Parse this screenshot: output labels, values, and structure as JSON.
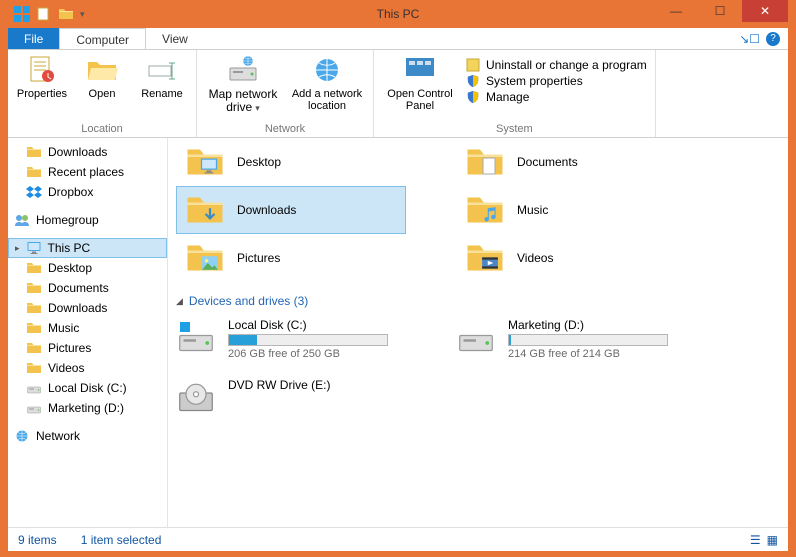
{
  "title": "This PC",
  "tabs": {
    "file": "File",
    "computer": "Computer",
    "view": "View"
  },
  "ribbon": {
    "location": {
      "label": "Location",
      "properties": "Properties",
      "open": "Open",
      "rename": "Rename"
    },
    "network": {
      "label": "Network",
      "map": "Map network drive",
      "add": "Add a network location"
    },
    "system": {
      "label": "System",
      "panel": "Open Control Panel",
      "uninstall": "Uninstall or change a program",
      "props": "System properties",
      "manage": "Manage"
    }
  },
  "nav": {
    "downloads": "Downloads",
    "recent": "Recent places",
    "dropbox": "Dropbox",
    "homegroup": "Homegroup",
    "thispc": "This PC",
    "desktop": "Desktop",
    "documents": "Documents",
    "downloads2": "Downloads",
    "music": "Music",
    "pictures": "Pictures",
    "videos": "Videos",
    "localc": "Local Disk (C:)",
    "marketingd": "Marketing (D:)",
    "network": "Network"
  },
  "folders": {
    "left": [
      "Desktop",
      "Downloads",
      "Pictures"
    ],
    "right": [
      "Documents",
      "Music",
      "Videos"
    ]
  },
  "section": {
    "devices": "Devices and drives (3)"
  },
  "drives": {
    "c": {
      "name": "Local Disk (C:)",
      "free": "206 GB free of 250 GB",
      "pct": 18
    },
    "d": {
      "name": "Marketing (D:)",
      "free": "214 GB free of 214 GB",
      "pct": 1
    },
    "dvd": {
      "name": "DVD RW Drive (E:)"
    }
  },
  "status": {
    "items": "9 items",
    "selected": "1 item selected"
  }
}
